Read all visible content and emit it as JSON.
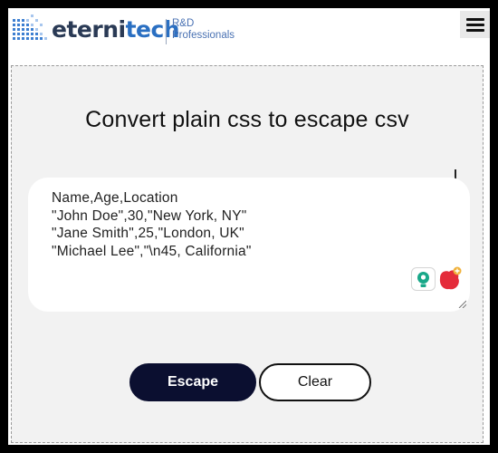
{
  "header": {
    "logo_word_main": "eterni",
    "logo_word_accent": "tech",
    "logo_sub_line1": "R&D",
    "logo_sub_line2": "Professionals",
    "menu_icon": "hamburger-icon"
  },
  "main": {
    "title": "Convert plain css to escape csv",
    "input_text": "Name,Age,Location\n\"John Doe\",30,\"New York, NY\"\n\"Jane Smith\",25,\"London, UK\"\n\"Michael Lee\",\"\\n45, California\"",
    "extension_icons": [
      "grammar-assistant-icon",
      "browser-extension-icon"
    ]
  },
  "actions": {
    "escape_label": "Escape",
    "clear_label": "Clear"
  },
  "colors": {
    "primary_button": "#0b0f30",
    "panel_background": "#f2f2f2",
    "logo_dark": "#2a3a55",
    "logo_accent": "#2a6fc2"
  }
}
